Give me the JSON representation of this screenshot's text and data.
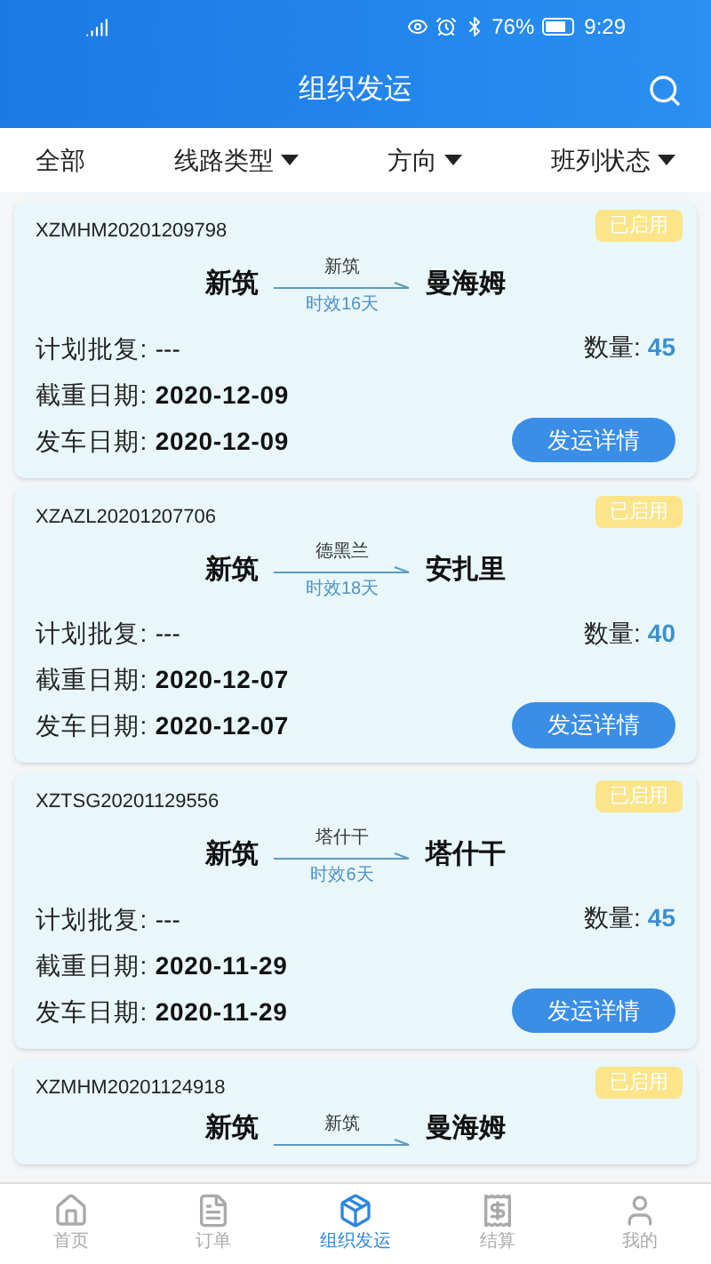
{
  "status_bar": {
    "battery": "76%",
    "time": "9:29"
  },
  "header": {
    "title": "组织发运"
  },
  "filters": [
    {
      "label": "全部",
      "dropdown": false
    },
    {
      "label": "线路类型",
      "dropdown": true
    },
    {
      "label": "方向",
      "dropdown": true
    },
    {
      "label": "班列状态",
      "dropdown": true
    }
  ],
  "cards": [
    {
      "id": "XZMHM20201209798",
      "badge": "已启用",
      "origin": "新筑",
      "via": "新筑",
      "destination": "曼海姆",
      "duration": "时效16天",
      "plan_label": "计划批复:",
      "plan": "---",
      "qty_label": "数量:",
      "qty": "45",
      "cutoff_label": "截重日期:",
      "cutoff": "2020-12-09",
      "depart_label": "发车日期:",
      "depart": "2020-12-09",
      "button": "发运详情"
    },
    {
      "id": "XZAZL20201207706",
      "badge": "已启用",
      "origin": "新筑",
      "via": "德黑兰",
      "destination": "安扎里",
      "duration": "时效18天",
      "plan_label": "计划批复:",
      "plan": "---",
      "qty_label": "数量:",
      "qty": "40",
      "cutoff_label": "截重日期:",
      "cutoff": "2020-12-07",
      "depart_label": "发车日期:",
      "depart": "2020-12-07",
      "button": "发运详情"
    },
    {
      "id": "XZTSG20201129556",
      "badge": "已启用",
      "origin": "新筑",
      "via": "塔什干",
      "destination": "塔什干",
      "duration": "时效6天",
      "plan_label": "计划批复:",
      "plan": "---",
      "qty_label": "数量:",
      "qty": "45",
      "cutoff_label": "截重日期:",
      "cutoff": "2020-11-29",
      "depart_label": "发车日期:",
      "depart": "2020-11-29",
      "button": "发运详情"
    },
    {
      "id": "XZMHM20201124918",
      "badge": "已启用",
      "origin": "新筑",
      "via": "新筑",
      "destination": "曼海姆"
    }
  ],
  "nav": [
    {
      "label": "首页",
      "selected": false
    },
    {
      "label": "订单",
      "selected": false
    },
    {
      "label": "组织发运",
      "selected": true
    },
    {
      "label": "结算",
      "selected": false
    },
    {
      "label": "我的",
      "selected": false
    }
  ]
}
